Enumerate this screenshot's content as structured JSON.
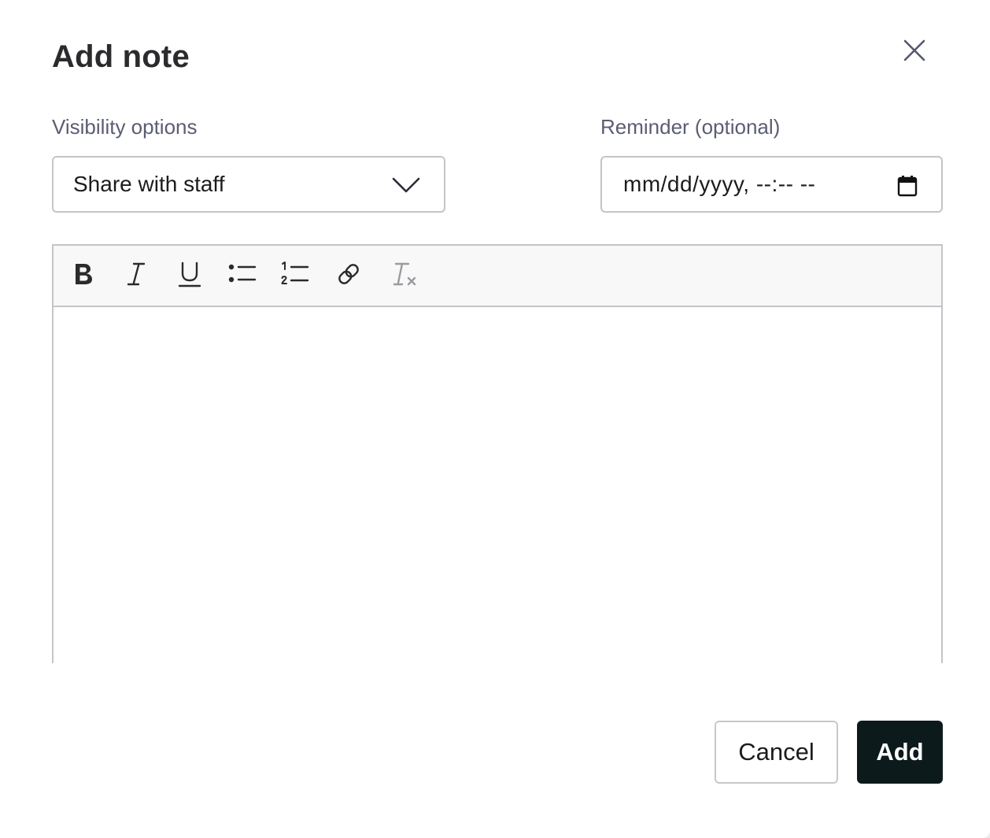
{
  "dialog": {
    "title": "Add note",
    "close_icon": "close-icon"
  },
  "visibility": {
    "label": "Visibility options",
    "selected": "Share with staff",
    "icon": "chevron-down-icon"
  },
  "reminder": {
    "label": "Reminder (optional)",
    "placeholder": "mm/dd/yyyy, --:-- --",
    "icon": "calendar-icon"
  },
  "editor": {
    "toolbar": [
      "bold-icon",
      "italic-icon",
      "underline-icon",
      "bullet-list-icon",
      "numbered-list-icon",
      "link-icon",
      "clear-formatting-icon"
    ],
    "content": ""
  },
  "footer": {
    "cancel_label": "Cancel",
    "add_label": "Add"
  },
  "colors": {
    "primary_button": "#0d1a1c",
    "label_text": "#5b5d73",
    "border": "#c4c4c9"
  }
}
